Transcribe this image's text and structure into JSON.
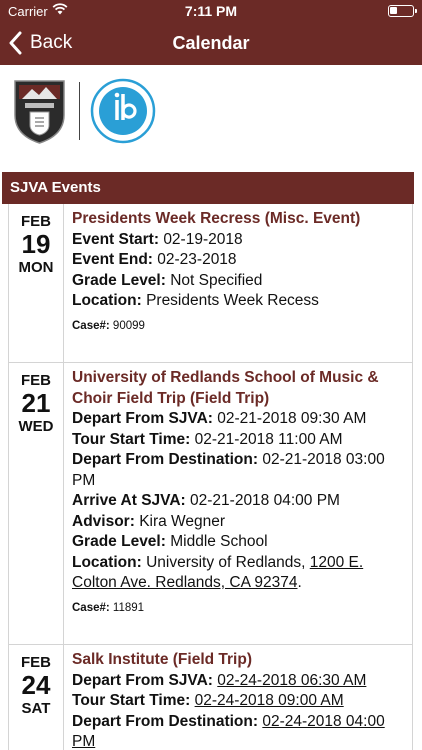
{
  "status_bar": {
    "carrier": "Carrier",
    "time": "7:11 PM"
  },
  "navbar": {
    "back_label": "Back",
    "title": "Calendar"
  },
  "section": {
    "title": "SJVA Events"
  },
  "events": [
    {
      "month": "FEB",
      "day": "19",
      "weekday": "MON",
      "title": "Presidents Week Recress (Misc. Event)",
      "event_start_label": "Event Start:",
      "event_start": "02-19-2018",
      "event_end_label": "Event End:",
      "event_end": "02-23-2018",
      "grade_label": "Grade Level:",
      "grade": "Not Specified",
      "location_label": "Location:",
      "location": "Presidents Week Recess",
      "case_label": "Case#:",
      "case": "90099"
    },
    {
      "month": "FEB",
      "day": "21",
      "weekday": "WED",
      "title": "University of Redlands School of Music & Choir Field Trip (Field Trip)",
      "depart_label": "Depart From SJVA:",
      "depart": "02-21-2018 09:30 AM",
      "tour_label": "Tour Start Time:",
      "tour": "02-21-2018 11:00 AM",
      "depart_dest_label": "Depart From Destination:",
      "depart_dest": "02-21-2018 03:00 PM",
      "arrive_label": "Arrive At SJVA:",
      "arrive": "02-21-2018 04:00 PM",
      "advisor_label": "Advisor:",
      "advisor": "Kira Wegner",
      "grade_label": "Grade Level:",
      "grade": "Middle School",
      "location_label": "Location:",
      "location_name": "University of Redlands, ",
      "location_address": "1200 E. Colton Ave. Redlands, CA 92374",
      "location_end": ".",
      "case_label": "Case#:",
      "case": "11891"
    },
    {
      "month": "FEB",
      "day": "24",
      "weekday": "SAT",
      "title": "Salk Institute (Field Trip)",
      "depart_label": "Depart From SJVA:",
      "depart": "02-24-2018 06:30 AM",
      "tour_label": "Tour Start Time:",
      "tour": "02-24-2018 09:00 AM",
      "depart_dest_label": "Depart From Destination:",
      "depart_dest": "02-24-2018 04:00 PM"
    }
  ]
}
